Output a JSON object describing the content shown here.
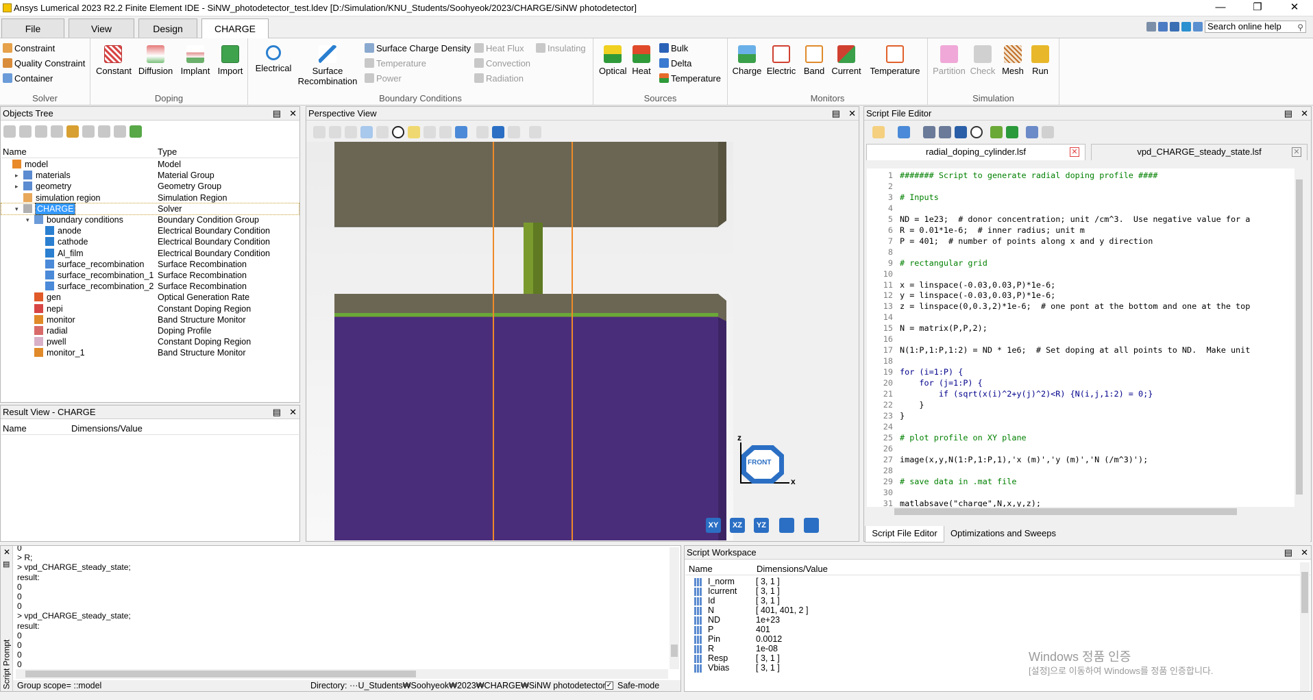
{
  "window": {
    "title": "Ansys Lumerical 2023 R2.2 Finite Element IDE - SiNW_photodetector_test.ldev [D:/Simulation/KNU_Students/Soohyeok/2023/CHARGE/SiNW photodetector]"
  },
  "menu_tabs": [
    "File",
    "View",
    "Design",
    "CHARGE"
  ],
  "search_placeholder": "Search online help",
  "ribbon": {
    "solver": {
      "label": "Solver",
      "items": [
        "Constraint",
        "Quality Constraint",
        "Container"
      ]
    },
    "doping": {
      "label": "Doping",
      "items": [
        "Constant",
        "Diffusion",
        "Implant",
        "Import"
      ]
    },
    "boundary": {
      "label": "Boundary Conditions",
      "electrical": "Electrical",
      "surface_recomb": [
        "Surface",
        "Recombination"
      ],
      "surface_charge": "Surface Charge Density",
      "temperature": "Temperature",
      "power": "Power",
      "heat_flux": "Heat Flux",
      "convection": "Convection",
      "radiation": "Radiation",
      "insulating": "Insulating"
    },
    "sources": {
      "label": "Sources",
      "optical": "Optical",
      "heat": "Heat",
      "bulk": "Bulk",
      "delta": "Delta",
      "temperature": "Temperature"
    },
    "monitors": {
      "label": "Monitors",
      "items": [
        "Charge",
        "Electric",
        "Band",
        "Current",
        "Temperature"
      ]
    },
    "simulation": {
      "label": "Simulation",
      "items": [
        "Partition",
        "Check",
        "Mesh",
        "Run"
      ]
    }
  },
  "objects_tree": {
    "title": "Objects Tree",
    "col_name": "Name",
    "col_type": "Type",
    "rows": [
      {
        "name": "model",
        "type": "Model"
      },
      {
        "name": "materials",
        "type": "Material Group"
      },
      {
        "name": "geometry",
        "type": "Geometry Group"
      },
      {
        "name": "simulation region",
        "type": "Simulation Region"
      },
      {
        "name": "CHARGE",
        "type": "Solver"
      },
      {
        "name": "boundary conditions",
        "type": "Boundary Condition Group"
      },
      {
        "name": "anode",
        "type": "Electrical Boundary Condition"
      },
      {
        "name": "cathode",
        "type": "Electrical Boundary Condition"
      },
      {
        "name": "Al_film",
        "type": "Electrical Boundary Condition"
      },
      {
        "name": "surface_recombination",
        "type": "Surface Recombination"
      },
      {
        "name": "surface_recombination_1",
        "type": "Surface Recombination"
      },
      {
        "name": "surface_recombination_2",
        "type": "Surface Recombination"
      },
      {
        "name": "gen",
        "type": "Optical Generation Rate"
      },
      {
        "name": "nepi",
        "type": "Constant Doping Region"
      },
      {
        "name": "monitor",
        "type": "Band Structure Monitor"
      },
      {
        "name": "radial",
        "type": "Doping Profile"
      },
      {
        "name": "pwell",
        "type": "Constant Doping Region"
      },
      {
        "name": "monitor_1",
        "type": "Band Structure Monitor"
      }
    ]
  },
  "result_view": {
    "title": "Result View - CHARGE",
    "col_name": "Name",
    "col_value": "Dimensions/Value"
  },
  "perspective_view": {
    "title": "Perspective View",
    "axis_z": "z",
    "axis_x": "x",
    "cube_label": "FRONT",
    "view_buttons": [
      "XY",
      "XZ",
      "YZ"
    ]
  },
  "script_editor": {
    "title": "Script File Editor",
    "tabs": [
      "radial_doping_cylinder.lsf",
      "vpd_CHARGE_steady_state.lsf"
    ],
    "bottom_tabs": [
      "Script File Editor",
      "Optimizations and Sweeps"
    ],
    "lines": [
      "####### Script to generate radial doping profile ####",
      "",
      "# Inputs",
      "",
      "ND = 1e23;  # donor concentration; unit /cm^3.  Use negative value for a",
      "R = 0.01*1e-6;  # inner radius; unit m",
      "P = 401;  # number of points along x and y direction",
      "",
      "# rectangular grid",
      "",
      "x = linspace(-0.03,0.03,P)*1e-6;",
      "y = linspace(-0.03,0.03,P)*1e-6;",
      "z = linspace(0,0.3,2)*1e-6;  # one pont at the bottom and one at the top",
      "",
      "N = matrix(P,P,2);",
      "",
      "N(1:P,1:P,1:2) = ND * 1e6;  # Set doping at all points to ND.  Make unit",
      "",
      "for (i=1:P) {",
      "    for (j=1:P) {",
      "        if (sqrt(x(i)^2+y(j)^2)<R) {N(i,j,1:2) = 0;}",
      "    }",
      "}",
      "",
      "# plot profile on XY plane",
      "",
      "image(x,y,N(1:P,1:P,1),'x (m)','y (m)','N (/m^3)');",
      "",
      "# save data in .mat file",
      "",
      "matlabsave(\"charge\",N,x,y,z);"
    ]
  },
  "script_prompt": {
    "title": "Script Prompt",
    "lines": [
      "0",
      "> R;",
      "> vpd_CHARGE_steady_state;",
      "result:",
      "0",
      "0",
      "0",
      "> vpd_CHARGE_steady_state;",
      "result:",
      "0",
      "0",
      "0",
      "0",
      ">"
    ]
  },
  "status": {
    "group_scope": "Group scope= ::model",
    "directory": "Directory: ···U_Students₩Soohyeok₩2023₩CHARGE₩SiNW photodetector",
    "safe_mode": "Safe-mode"
  },
  "workspace": {
    "title": "Script Workspace",
    "col_name": "Name",
    "col_value": "Dimensions/Value",
    "rows": [
      {
        "name": "I_norm",
        "value": "[ 3, 1 ]"
      },
      {
        "name": "Icurrent",
        "value": "[ 3, 1 ]"
      },
      {
        "name": "Id",
        "value": "[ 3, 1 ]"
      },
      {
        "name": "N",
        "value": "[ 401, 401, 2 ]"
      },
      {
        "name": "ND",
        "value": "1e+23"
      },
      {
        "name": "P",
        "value": "401"
      },
      {
        "name": "Pin",
        "value": "0.0012"
      },
      {
        "name": "R",
        "value": "1e-08"
      },
      {
        "name": "Resp",
        "value": "[ 3, 1 ]"
      },
      {
        "name": "Vbias",
        "value": "[ 3, 1 ]"
      }
    ]
  },
  "watermark": {
    "line1": "Windows 정품 인증",
    "line2": "[설정]으로 이동하여 Windows를 정품 인증합니다."
  }
}
